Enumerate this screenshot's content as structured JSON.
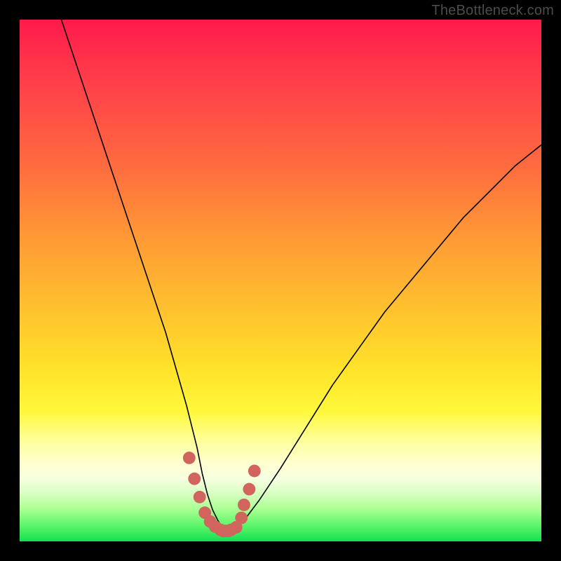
{
  "watermark": "TheBottleneck.com",
  "chart_data": {
    "type": "line",
    "title": "",
    "xlabel": "",
    "ylabel": "",
    "xlim": [
      0,
      100
    ],
    "ylim": [
      0,
      100
    ],
    "grid": false,
    "series": [
      {
        "name": "bottleneck-curve",
        "color": "#000000",
        "x": [
          8,
          10,
          12,
          14,
          16,
          18,
          20,
          22,
          24,
          26,
          28,
          30,
          32,
          34,
          35,
          36,
          37,
          38,
          39,
          40,
          41,
          43,
          46,
          50,
          55,
          60,
          65,
          70,
          75,
          80,
          85,
          90,
          95,
          100
        ],
        "y_pct": [
          100,
          94,
          88,
          82,
          76,
          70,
          64,
          58,
          52,
          46,
          40,
          33,
          26,
          18,
          13,
          9,
          6,
          4,
          2.5,
          2,
          2.5,
          4,
          8,
          14,
          22,
          30,
          37,
          44,
          50,
          56,
          62,
          67,
          72,
          76
        ]
      }
    ],
    "valley_markers": {
      "color": "#d2645e",
      "radius_pct": 1.2,
      "x": [
        32.5,
        33.5,
        34.5,
        35.5,
        36.5,
        37.5,
        38.5,
        39.0,
        39.5,
        40.0,
        40.5,
        41.5,
        42.5,
        43.0,
        44.0,
        45.0
      ],
      "y_pct": [
        16.0,
        12.0,
        8.5,
        5.5,
        3.8,
        2.8,
        2.2,
        2.0,
        2.0,
        2.0,
        2.2,
        2.7,
        4.5,
        7.0,
        10.0,
        13.5
      ]
    }
  }
}
